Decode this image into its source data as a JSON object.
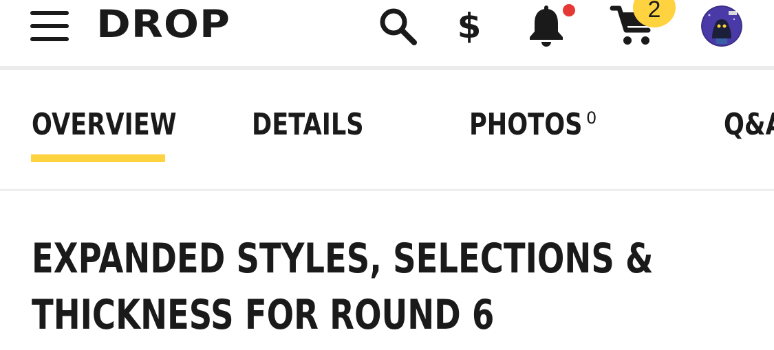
{
  "header": {
    "brand": "DROP",
    "currency_symbol": "$",
    "cart_count": "2",
    "icons": [
      "menu-icon",
      "search-icon",
      "currency-icon",
      "bell-icon",
      "cart-icon"
    ],
    "has_unread_notifications": true
  },
  "tabs": [
    {
      "label": "OVERVIEW",
      "active": true
    },
    {
      "label": "DETAILS",
      "active": false
    },
    {
      "label": "PHOTOS",
      "count": "0",
      "active": false
    },
    {
      "label": "Q&A",
      "active": false
    }
  ],
  "main": {
    "title": "EXPANDED STYLES, SELECTIONS & THICKNESS FOR ROUND 6"
  },
  "colors": {
    "accent": "#ffd23f",
    "notification": "#e53935",
    "text": "#1a1a1a",
    "divider": "#ececec"
  }
}
